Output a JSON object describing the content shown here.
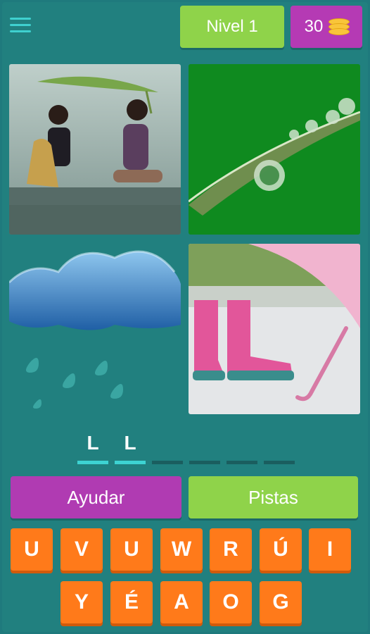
{
  "header": {
    "level_label": "Nivel 1",
    "coins": "30"
  },
  "answer": {
    "slots": [
      "L",
      "L",
      "",
      "",
      "",
      ""
    ]
  },
  "actions": {
    "help_label": "Ayudar",
    "hints_label": "Pistas"
  },
  "keys": {
    "row1": [
      "U",
      "V",
      "U",
      "W",
      "R",
      "Ú",
      "I"
    ],
    "row2": [
      "Y",
      "É",
      "A",
      "O",
      "G"
    ]
  },
  "colors": {
    "background": "#21807f",
    "purple": "#b03bb2",
    "green": "#8fd34a",
    "orange": "#ff7a1a",
    "slot_active": "#3dd3d2"
  }
}
